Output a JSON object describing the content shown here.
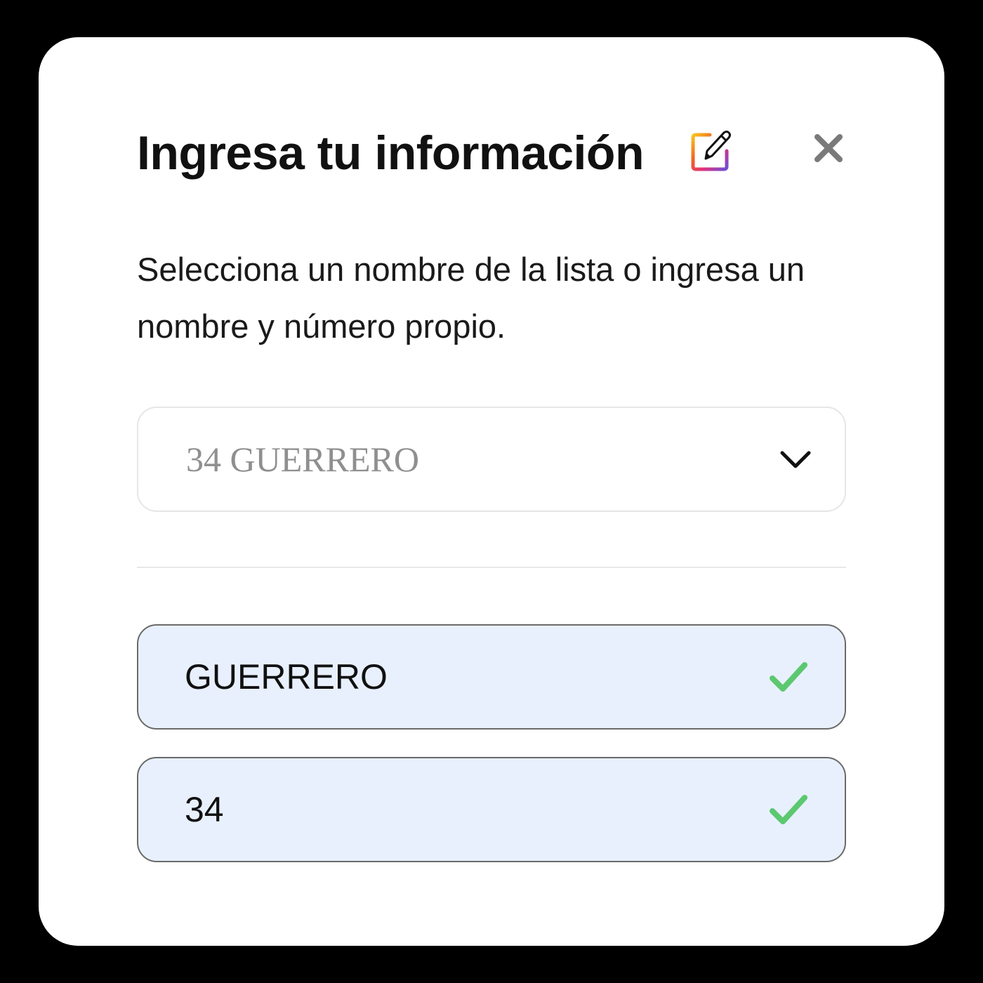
{
  "modal": {
    "title": "Ingresa tu información",
    "title_icon": "memo-pencil-icon",
    "close_icon": "close-icon",
    "subtitle": "Selecciona un nombre de la lista o ingresa un nombre y número propio."
  },
  "select": {
    "value": "34 GUERRERO",
    "icon": "chevron-down-icon"
  },
  "fields": {
    "name_value": "GUERRERO",
    "number_value": "34",
    "valid_icon": "check-icon"
  },
  "colors": {
    "field_background": "#e8f0fe",
    "check": "#5cc870",
    "close": "#7a7a7a"
  }
}
